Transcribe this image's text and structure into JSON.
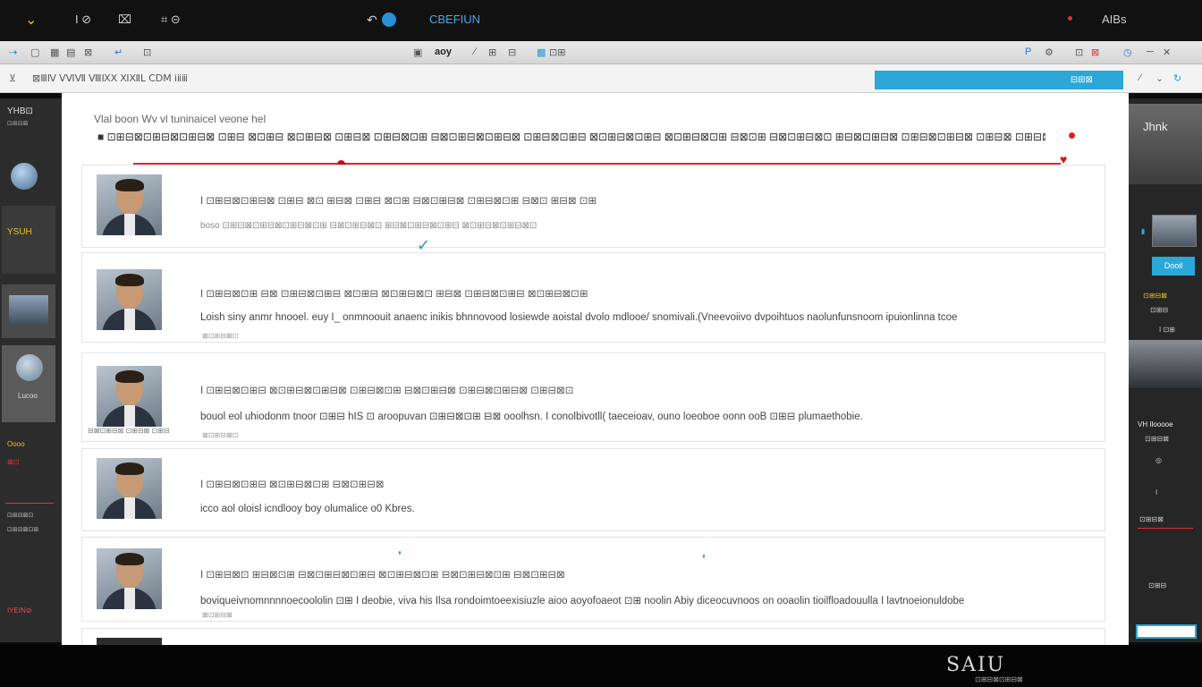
{
  "topbar": {
    "left_items": [
      "I ⊘",
      "⌧",
      "⌗ ⊝"
    ],
    "center_title": "CBEFIUN",
    "right_text": "AIBs"
  },
  "toolbar": {
    "center_label": "aoy"
  },
  "urlbar": {
    "path": "⊠ⅢⅣ ⅤⅥⅦ ⅧⅨⅩ ⅪⅫⅬ ⅭⅮⅯ ⅰⅱⅲ",
    "button_label": "⊟⊞⊠"
  },
  "left_panel": {
    "title": "YHB⊡",
    "items": [
      "YSUH",
      "Lucoo",
      "Oooo"
    ],
    "footer_label": "IYEIN⊘"
  },
  "main": {
    "header": "Vlal boon  Wv vl tuninaicel veone hel",
    "rows": [
      {
        "line1": "I  ⊡⊞⊟⊠⊡⊞⊟⊠ ⊡⊞⊟ ⊠⊡ ⊞⊟⊠ ⊡⊞⊟ ⊠⊡⊞ ⊟⊠⊡⊞⊟⊠ ⊡⊞⊟⊠⊡⊞ ⊟⊠⊡ ⊞⊟⊠ ⊡⊞",
        "line2": "boso  ⊡⊞⊟⊠⊡⊞⊟⊠⊡⊞⊟⊠⊡⊞ ⊟⊠⊡⊞⊟⊠⊡ ⊞⊟⊠⊡⊞⊟⊠⊡⊞⊟ ⊠⊡⊞⊟⊠⊡⊞⊟⊠⊡",
        "tiny": ""
      },
      {
        "line1": "I  ⊡⊞⊟⊠⊡⊞ ⊟⊠ ⊡⊞⊟⊠⊡⊞⊟ ⊠⊡⊞⊟ ⊠⊡⊞⊟⊠⊡ ⊞⊟⊠ ⊡⊞⊟⊠⊡⊞⊟ ⊠⊡⊞⊟⊠⊡⊞",
        "line2": "Loish siny anmr hnooel. euy I_ onmnoouit anaenc inikis  bhnnovood losiewde aoistal dvolo mdlooe/ snomivali.(Vneevoiivo dvpoihtuos naolunfunsnoom ipuionlinna tcoe",
        "tiny": "⊠⊡⊞⊟⊠⊡"
      },
      {
        "line1": "I  ⊡⊞⊟⊠⊡⊞⊟ ⊠⊡⊞⊟⊠⊡⊞⊟⊠ ⊡⊞⊟⊠⊡⊞ ⊟⊠⊡⊞⊟⊠ ⊡⊞⊟⊠⊡⊞⊟⊠ ⊡⊞⊟⊠⊡",
        "line2": "bouol eol uhiodonm tnoor ⊡⊞⊟ hIS ⊡ aroopuvan ⊡⊞⊟⊠⊡⊞ ⊟⊠ ooolhsn. I conolbivotll( taeceioav, ouno loeoboe  oonn ooB ⊡⊞⊟ plumaethobie.",
        "tiny": "⊠⊡⊞⊟⊠⊡"
      },
      {
        "line1": "I  ⊡⊞⊟⊠⊡⊞⊟ ⊠⊡⊞⊟⊠⊡⊞ ⊟⊠⊡⊞⊟⊠",
        "line2": "icco aol oloisl  icndlooy boy olumalice o0 Kbres.",
        "tiny": ""
      },
      {
        "line1": "I  ⊡⊞⊟⊠⊡ ⊞⊟⊠⊡⊞ ⊟⊠⊡⊞⊟⊠⊡⊞⊟ ⊠⊡⊞⊟⊠⊡⊞ ⊟⊠⊡⊞⊟⊠⊡⊞ ⊟⊠⊡⊞⊟⊠",
        "line2": "boviqueivnomnnnnoecoololin ⊡⊞ I  deobie, viva his  Ilsa  rondoimtoeexisiuzle aioo aoyofoaeot ⊡⊞ noolin Abiy  diceocuvnoos on ooaolin tioilfloadouulla I lavtnoeionuldobe",
        "tiny": "⊠⊡⊞⊟⊠"
      }
    ],
    "caption": "⊟⊠⊡⊞⊟⊠ ⊡⊞⊟⊠ ⊡⊞⊟"
  },
  "right_panel": {
    "title": "Jhnk",
    "button_label": "Dooil",
    "texts": [
      "VH Ilooooe",
      "⊡⊞⊟⊠",
      "⊡⊞⊟",
      "I ⊡⊞",
      "⊡⊞⊟⊠",
      "I",
      "⊡⊞⊟⊠",
      "⊡⊞⊟"
    ]
  },
  "footer": {
    "logo": "SAIU",
    "logo_sub": "⊡⊞⊟⊠⊡⊞⊟⊠"
  },
  "colors": {
    "accent": "#2ba8d8",
    "marker_red": "#e02a2a"
  }
}
